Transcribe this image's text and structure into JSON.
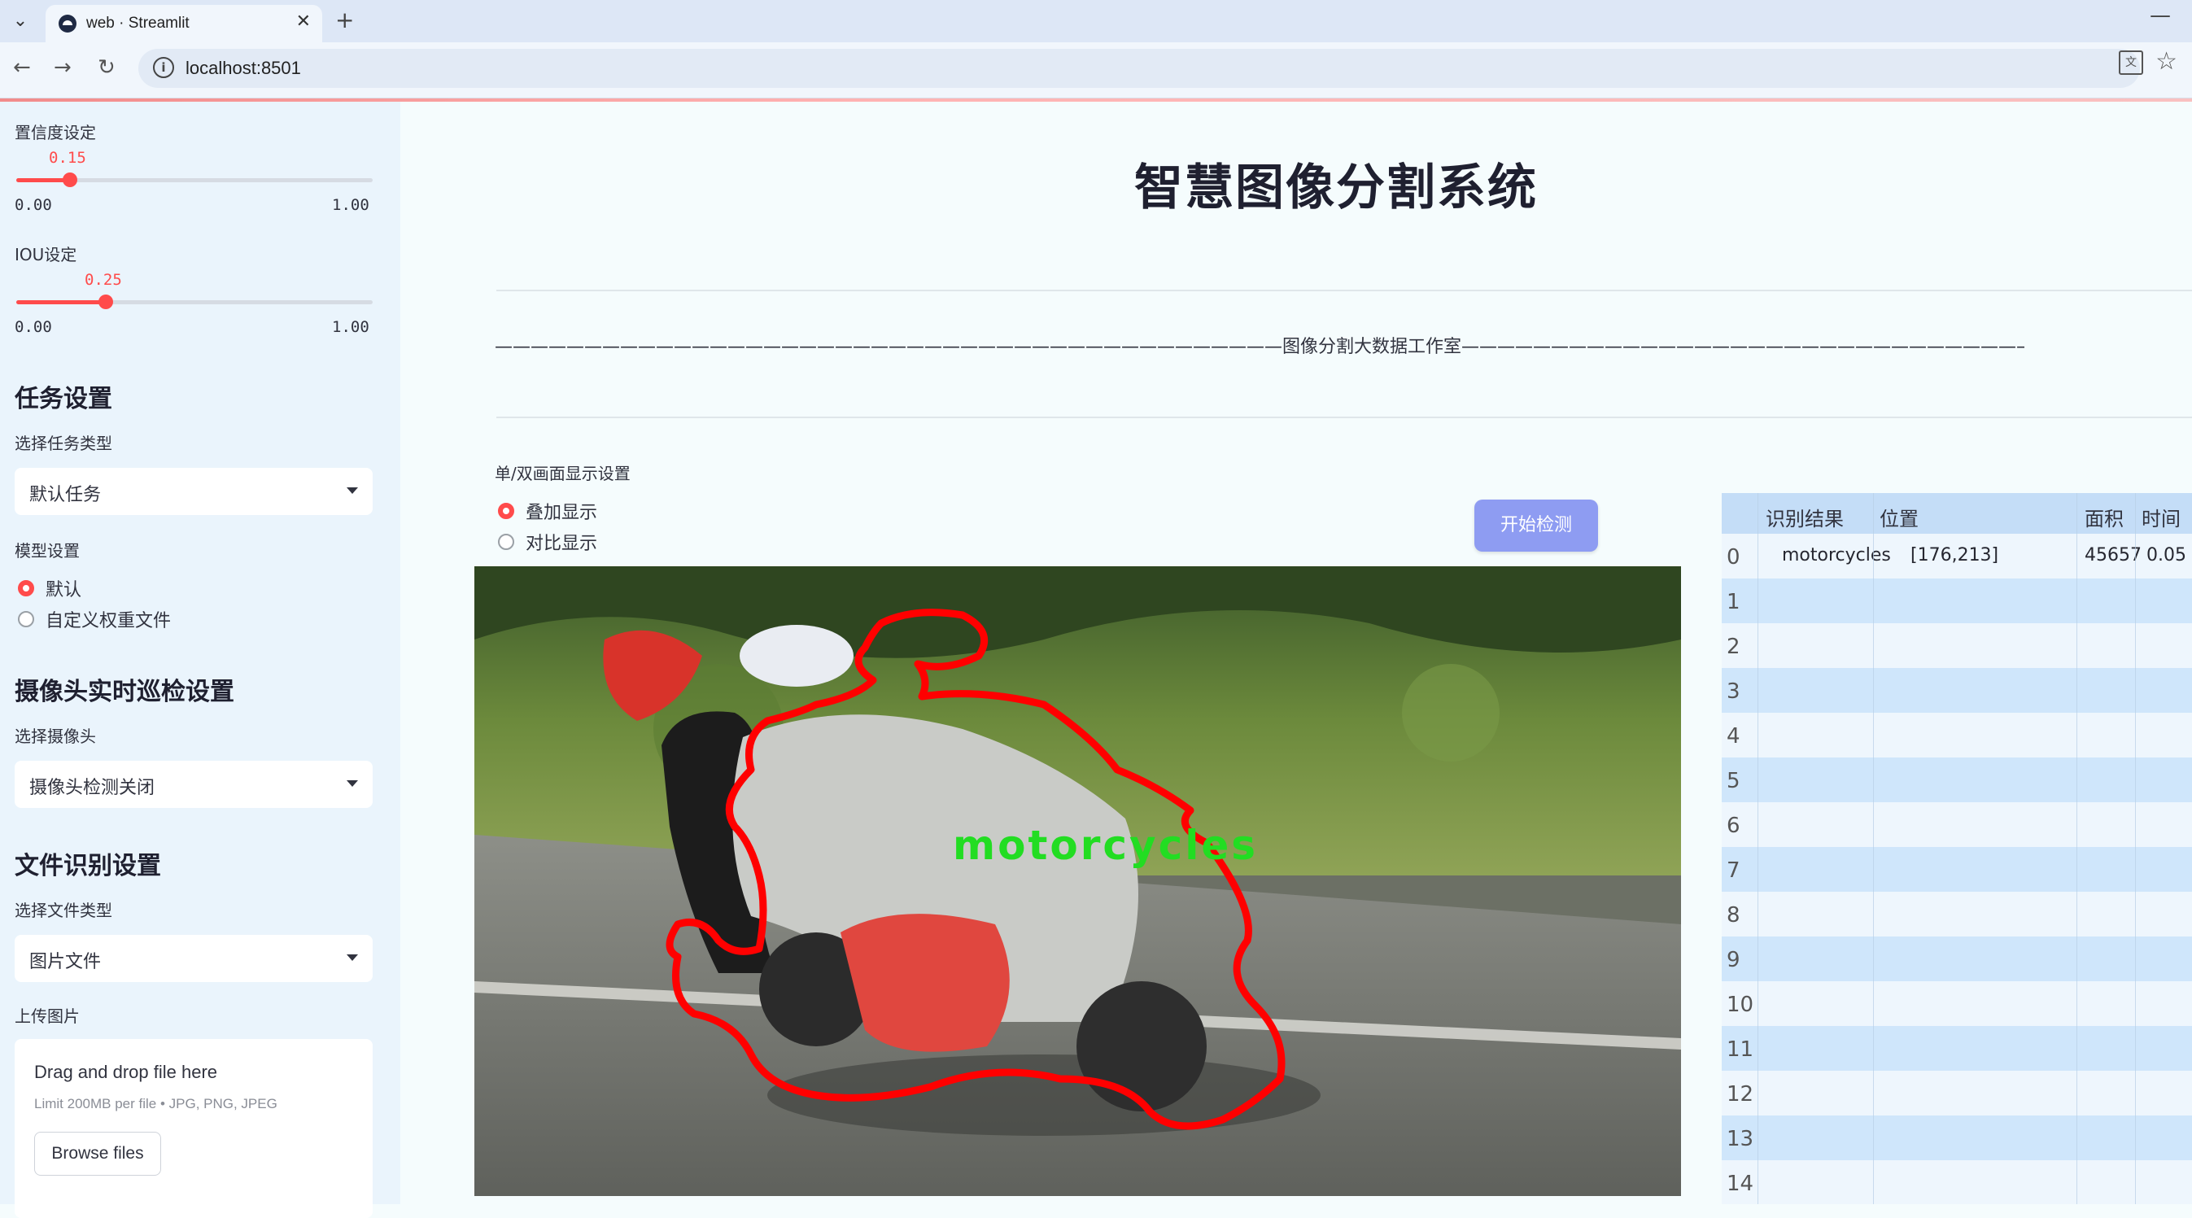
{
  "browser": {
    "tab_title": "web · Streamlit",
    "url": "localhost:8501"
  },
  "sidebar": {
    "confidence": {
      "label": "置信度设定",
      "value": "0.15",
      "value_fraction": 0.15,
      "min": "0.00",
      "max": "1.00"
    },
    "iou": {
      "label": "IOU设定",
      "value": "0.25",
      "value_fraction": 0.25,
      "min": "0.00",
      "max": "1.00"
    },
    "task": {
      "title": "任务设置",
      "select_label": "选择任务类型",
      "selected": "默认任务"
    },
    "model": {
      "label": "模型设置",
      "options": [
        "默认",
        "自定义权重文件"
      ],
      "selected_index": 0
    },
    "camera": {
      "title": "摄像头实时巡检设置",
      "select_label": "选择摄像头",
      "selected": "摄像头检测关闭"
    },
    "file": {
      "title": "文件识别设置",
      "select_label": "选择文件类型",
      "selected": "图片文件"
    },
    "upload": {
      "label": "上传图片",
      "drop_text": "Drag and drop file here",
      "limit_text": "Limit 200MB per file • JPG, PNG, JPEG",
      "button": "Browse files"
    }
  },
  "main": {
    "title": "智慧图像分割系统",
    "banner": "————————————————————————————————————————————图像分割大数据工作室————————————————————————————————————————————",
    "display_mode": {
      "label": "单/双画面显示设置",
      "options": [
        "叠加显示",
        "对比显示"
      ],
      "selected_index": 0
    },
    "start_button": "开始检测",
    "overlay_label": "motorcycles"
  },
  "table": {
    "columns": [
      "识别结果",
      "位置",
      "面积",
      "时间"
    ],
    "rows": [
      {
        "index": "0",
        "result": "motorcycles",
        "position": "[176,213]",
        "area": "45657",
        "time": "0.05"
      },
      {
        "index": "1",
        "result": "",
        "position": "",
        "area": "",
        "time": ""
      },
      {
        "index": "2",
        "result": "",
        "position": "",
        "area": "",
        "time": ""
      },
      {
        "index": "3",
        "result": "",
        "position": "",
        "area": "",
        "time": ""
      },
      {
        "index": "4",
        "result": "",
        "position": "",
        "area": "",
        "time": ""
      },
      {
        "index": "5",
        "result": "",
        "position": "",
        "area": "",
        "time": ""
      },
      {
        "index": "6",
        "result": "",
        "position": "",
        "area": "",
        "time": ""
      },
      {
        "index": "7",
        "result": "",
        "position": "",
        "area": "",
        "time": ""
      },
      {
        "index": "8",
        "result": "",
        "position": "",
        "area": "",
        "time": ""
      },
      {
        "index": "9",
        "result": "",
        "position": "",
        "area": "",
        "time": ""
      },
      {
        "index": "10",
        "result": "",
        "position": "",
        "area": "",
        "time": ""
      },
      {
        "index": "11",
        "result": "",
        "position": "",
        "area": "",
        "time": ""
      },
      {
        "index": "12",
        "result": "",
        "position": "",
        "area": "",
        "time": ""
      },
      {
        "index": "13",
        "result": "",
        "position": "",
        "area": "",
        "time": ""
      },
      {
        "index": "14",
        "result": "",
        "position": "",
        "area": "",
        "time": ""
      }
    ]
  },
  "colors": {
    "accent": "#ff4b4b",
    "button": "#8e9cf2",
    "mask_outline": "#ff0000",
    "label_text": "#22dd22"
  }
}
